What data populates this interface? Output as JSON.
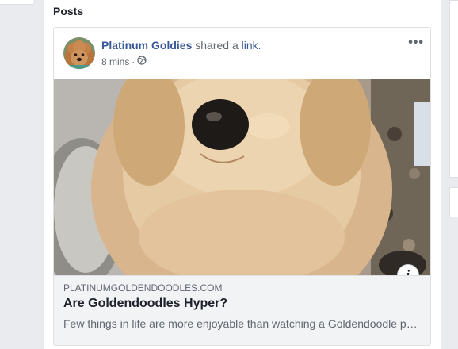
{
  "section": {
    "title": "Posts"
  },
  "post": {
    "author": "Platinum Goldies",
    "action_text": "shared a",
    "action_link": "link",
    "action_period": ".",
    "time": "8 mins",
    "separator": "·",
    "privacy_icon": "globe-icon",
    "more_icon": "•••"
  },
  "link_preview": {
    "info_icon": "i",
    "domain": "PLATINUMGOLDENDOODLES.COM",
    "title": "Are Goldendoodles Hyper?",
    "description": "Few things in life are more enjoyable than watching a Goldendoodle puppy play"
  },
  "colors": {
    "link_blue": "#385898",
    "meta_gray": "#606770",
    "panel_bg": "#e9ebee",
    "footer_bg": "#f2f3f5"
  }
}
